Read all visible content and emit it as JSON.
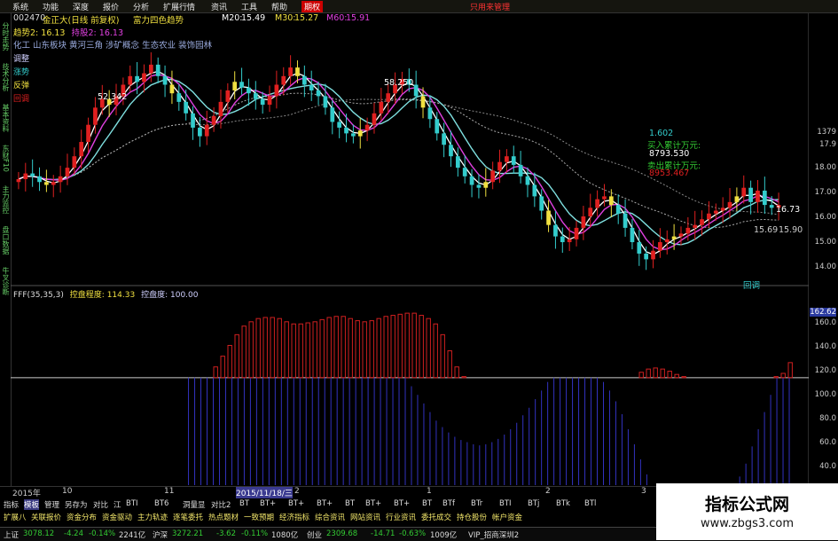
{
  "menubar": {
    "items": [
      "系统",
      "功能",
      "深度",
      "报价",
      "分析",
      "扩展行情",
      "资讯",
      "工具",
      "帮助",
      "期权"
    ],
    "ad": "只用来管理"
  },
  "info": {
    "code": "002470",
    "name": "金正大(日线 前复权)",
    "indicator": "富力四色趋势",
    "ma20_label": "M20:",
    "ma20": "15.49",
    "ma30_label": "M30:",
    "ma30": "15.27",
    "ma60_label": "M60:",
    "ma60": "15.91",
    "trend_label": "趋势2:",
    "trend": "16.13",
    "control_label": "持股2:",
    "control": "16.13",
    "concepts": "化工 山东板块 黄河三角 涉矿概念 生态农业 装饰园林"
  },
  "legend": {
    "l1": "调整",
    "l2": "涨势",
    "l3": "反弹",
    "l4": "回调"
  },
  "annot": {
    "peak": "58.250",
    "left_val": "52.342",
    "a1": "1.602",
    "buy_label": "买入累计万元:",
    "buy_val": "8793.530",
    "sell_label": "卖出累计万元:",
    "sell_val": "8953.467",
    "last": "16.73",
    "last2": "15.69",
    "last3": "15.90",
    "vol_note": "回调"
  },
  "lower": {
    "title": "FFF(35,35,3)",
    "label1": "控盘程度:",
    "val1": "114.33",
    "label2": "控盘度:",
    "val2": "100.00",
    "current": "162.62"
  },
  "yaxis_upper": [
    "17.9",
    "18.00",
    "17.00",
    "16.00",
    "15.00",
    "14.00"
  ],
  "yaxis_upper_top": "1379",
  "yaxis_lower": [
    "160.0",
    "140.0",
    "120.0",
    "100.0",
    "80.0",
    "60.0",
    "40.0",
    "20.0"
  ],
  "sidebar_labels": [
    "分时走势",
    "技术分析",
    "基本资料",
    "东财F10",
    "主力监控",
    "盘口数据",
    "牛叉诊断"
  ],
  "dates": {
    "d1": "2015年",
    "d2": "10",
    "d3": "11",
    "d4": "2015/11/18/三",
    "d5": "2",
    "d6": "1",
    "d7": "2",
    "d8": "3"
  },
  "tabs1": [
    "指标",
    "模板",
    "管理",
    "另存为",
    "对比",
    "江",
    "BTI",
    "BT6",
    "洞量显",
    "对比2",
    "BT",
    "BT+",
    "BT+",
    "BT+",
    "BT",
    "BT+",
    "BT+",
    "BT",
    "BTf",
    "BTr",
    "BTI",
    "BTj",
    "BTk",
    "BTl"
  ],
  "tabs2": [
    "扩展八",
    "关联报价",
    "资金分布",
    "资金驱动",
    "主力轨迹",
    "逐笔委托",
    "热点题材",
    "一致预期",
    "经济指标",
    "综合资讯",
    "网站资讯",
    "行业资讯",
    "委托成交",
    "持仓股份",
    "帐户资金"
  ],
  "status": {
    "sh_label": "上证",
    "sh_val": "3078.12",
    "sh_chg": "-4.24",
    "sh_pct": "-0.14%",
    "sh_amt": "2241亿",
    "hs_label": "沪深",
    "hs_val": "3272.21",
    "hs_chg": "-3.62",
    "hs_pct": "-0.11%",
    "hs_amt": "1080亿",
    "cy_label": "创业",
    "cy_val": "2309.68",
    "cy_chg": "-14.71",
    "cy_pct": "-0.63%",
    "cy_amt": "1009亿",
    "vip": "VIP_招商深圳2"
  },
  "watermark": {
    "title": "指标公式网",
    "url": "www.zbgs3.com"
  },
  "colors": {
    "up": "#e02020",
    "down": "#33cccc",
    "yellow": "#f0e040",
    "white": "#ffffff",
    "magenta": "#e040e0",
    "cyan_ma": "#7fe0e0"
  },
  "chart_data": {
    "type": "candlestick",
    "price_range": [
      13.5,
      19.4
    ],
    "close": [
      17.0,
      17.2,
      17.1,
      16.9,
      16.8,
      16.9,
      17.1,
      17.4,
      17.8,
      18.3,
      18.9,
      19.5,
      19.8,
      19.6,
      19.9,
      20.3,
      20.6,
      20.4,
      20.7,
      21.0,
      20.6,
      20.3,
      20.0,
      19.7,
      19.3,
      18.8,
      18.5,
      18.9,
      19.2,
      19.7,
      20.1,
      20.4,
      20.2,
      20.0,
      19.8,
      19.6,
      19.9,
      20.3,
      20.6,
      20.9,
      20.6,
      20.3,
      20.1,
      19.9,
      19.5,
      19.0,
      18.8,
      18.6,
      18.5,
      18.7,
      18.9,
      19.3,
      19.7,
      20.0,
      20.3,
      20.5,
      20.3,
      19.9,
      19.5,
      19.1,
      18.6,
      18.2,
      17.8,
      17.4,
      17.1,
      16.8,
      16.7,
      16.9,
      17.3,
      17.6,
      17.8,
      17.5,
      17.1,
      16.8,
      16.4,
      15.9,
      15.4,
      15.0,
      14.8,
      14.9,
      15.3,
      15.7,
      16.0,
      16.3,
      16.4,
      16.1,
      15.8,
      15.3,
      14.8,
      14.4,
      14.2,
      14.5,
      14.8,
      14.9,
      15.0,
      15.1,
      15.3,
      15.4,
      15.6,
      15.8,
      15.9,
      16.0,
      16.2,
      16.4,
      16.7,
      16.2,
      16.6,
      16.1,
      16.0,
      16.1
    ],
    "lower_red": [
      0,
      0,
      0,
      0,
      0,
      0,
      0,
      0,
      0,
      0,
      0,
      0,
      0,
      0,
      0,
      0,
      0,
      0,
      0,
      0,
      0,
      0,
      0,
      0,
      0,
      0,
      0,
      0,
      110,
      120,
      130,
      140,
      148,
      152,
      155,
      156,
      156,
      155,
      152,
      150,
      150,
      151,
      152,
      154,
      156,
      157,
      157,
      155,
      153,
      152,
      153,
      155,
      157,
      158,
      159,
      160,
      160,
      158,
      155,
      150,
      140,
      125,
      110,
      101,
      100,
      100,
      100,
      100,
      100,
      100,
      100,
      100,
      100,
      100,
      100,
      100,
      100,
      100,
      100,
      100,
      100,
      100,
      100,
      100,
      100,
      100,
      100,
      100,
      105,
      108,
      109,
      108,
      106,
      103,
      101,
      100,
      100,
      100,
      100,
      100,
      100,
      100,
      100,
      100,
      100,
      100,
      100,
      101,
      104,
      114
    ],
    "lower_blue": [
      0,
      0,
      0,
      0,
      0,
      0,
      0,
      0,
      0,
      0,
      0,
      0,
      0,
      0,
      0,
      0,
      0,
      0,
      0,
      0,
      0,
      0,
      0,
      0,
      0,
      0,
      0,
      0,
      100,
      100,
      100,
      100,
      100,
      100,
      100,
      100,
      100,
      100,
      100,
      100,
      100,
      100,
      100,
      100,
      100,
      100,
      100,
      100,
      100,
      100,
      100,
      100,
      100,
      100,
      100,
      100,
      100,
      100,
      100,
      100,
      100,
      100,
      100,
      100,
      92,
      84,
      76,
      68,
      60,
      54,
      49,
      45,
      42,
      40,
      38,
      37,
      38,
      40,
      43,
      47,
      52,
      58,
      65,
      72,
      80,
      88,
      96,
      100,
      100,
      100,
      100,
      100,
      100,
      100,
      100,
      96,
      88,
      78,
      66,
      52,
      38,
      24,
      10,
      0,
      0,
      0,
      0,
      0,
      0,
      0,
      0,
      0,
      0,
      0,
      0,
      0,
      0,
      8,
      20,
      36,
      52,
      68,
      84,
      100,
      100,
      100
    ]
  }
}
